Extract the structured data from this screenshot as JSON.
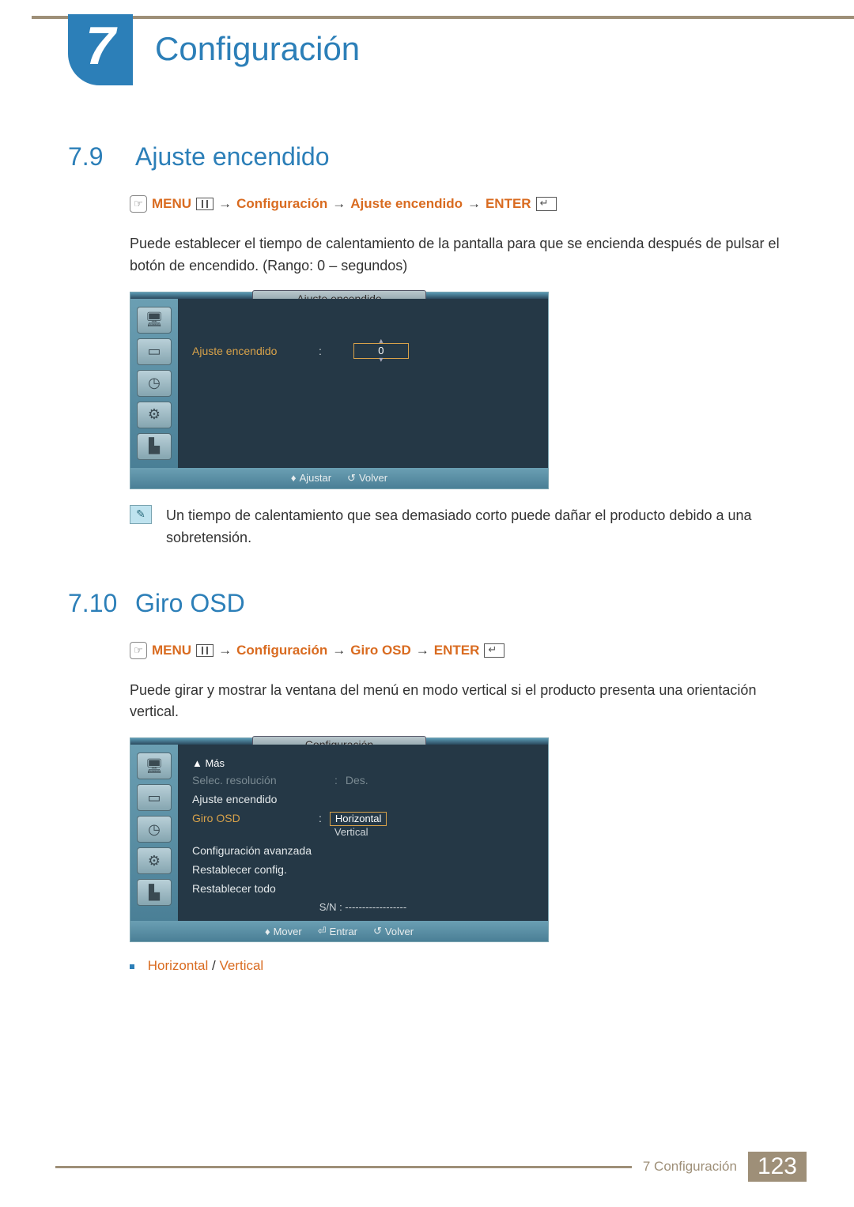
{
  "chapter": {
    "number": "7",
    "title": "Configuración"
  },
  "section1": {
    "num": "7.9",
    "title": "Ajuste encendido",
    "nav": {
      "menu": "MENU",
      "path1": "Configuración",
      "path2": "Ajuste encendido",
      "enter": "ENTER"
    },
    "body": "Puede establecer el tiempo de calentamiento de la pantalla para que se encienda después de pulsar el botón de encendido. (Rango: 0 – segundos)",
    "osd": {
      "title": "Ajuste encendido",
      "label": "Ajuste encendido",
      "colon": ":",
      "value": "0",
      "footer_adjust": "Ajustar",
      "footer_return": "Volver"
    },
    "note": "Un tiempo de calentamiento que sea demasiado corto puede dañar el producto debido a una sobretensión."
  },
  "section2": {
    "num": "7.10",
    "title": "Giro OSD",
    "nav": {
      "menu": "MENU",
      "path1": "Configuración",
      "path2": "Giro OSD",
      "enter": "ENTER"
    },
    "body": "Puede girar y mostrar la ventana del menú en modo vertical si el producto presenta una orientación vertical.",
    "osd": {
      "title": "Configuración",
      "more": "▲ Más",
      "items": {
        "selec": "Selec. resolución",
        "selec_val": "Des.",
        "ajuste": "Ajuste encendido",
        "giro": "Giro OSD",
        "giro_opt1": "Horizontal",
        "giro_opt2": "Vertical",
        "avanzada": "Configuración avanzada",
        "restablecer": "Restablecer config.",
        "restablecer_todo": "Restablecer todo",
        "sn": "S/N : ------------------"
      },
      "footer_move": "Mover",
      "footer_enter": "Entrar",
      "footer_return": "Volver"
    },
    "bullet": {
      "opt1": "Horizontal",
      "sep": " / ",
      "opt2": "Vertical"
    }
  },
  "footer": {
    "section": "7 Configuración",
    "page": "123"
  }
}
